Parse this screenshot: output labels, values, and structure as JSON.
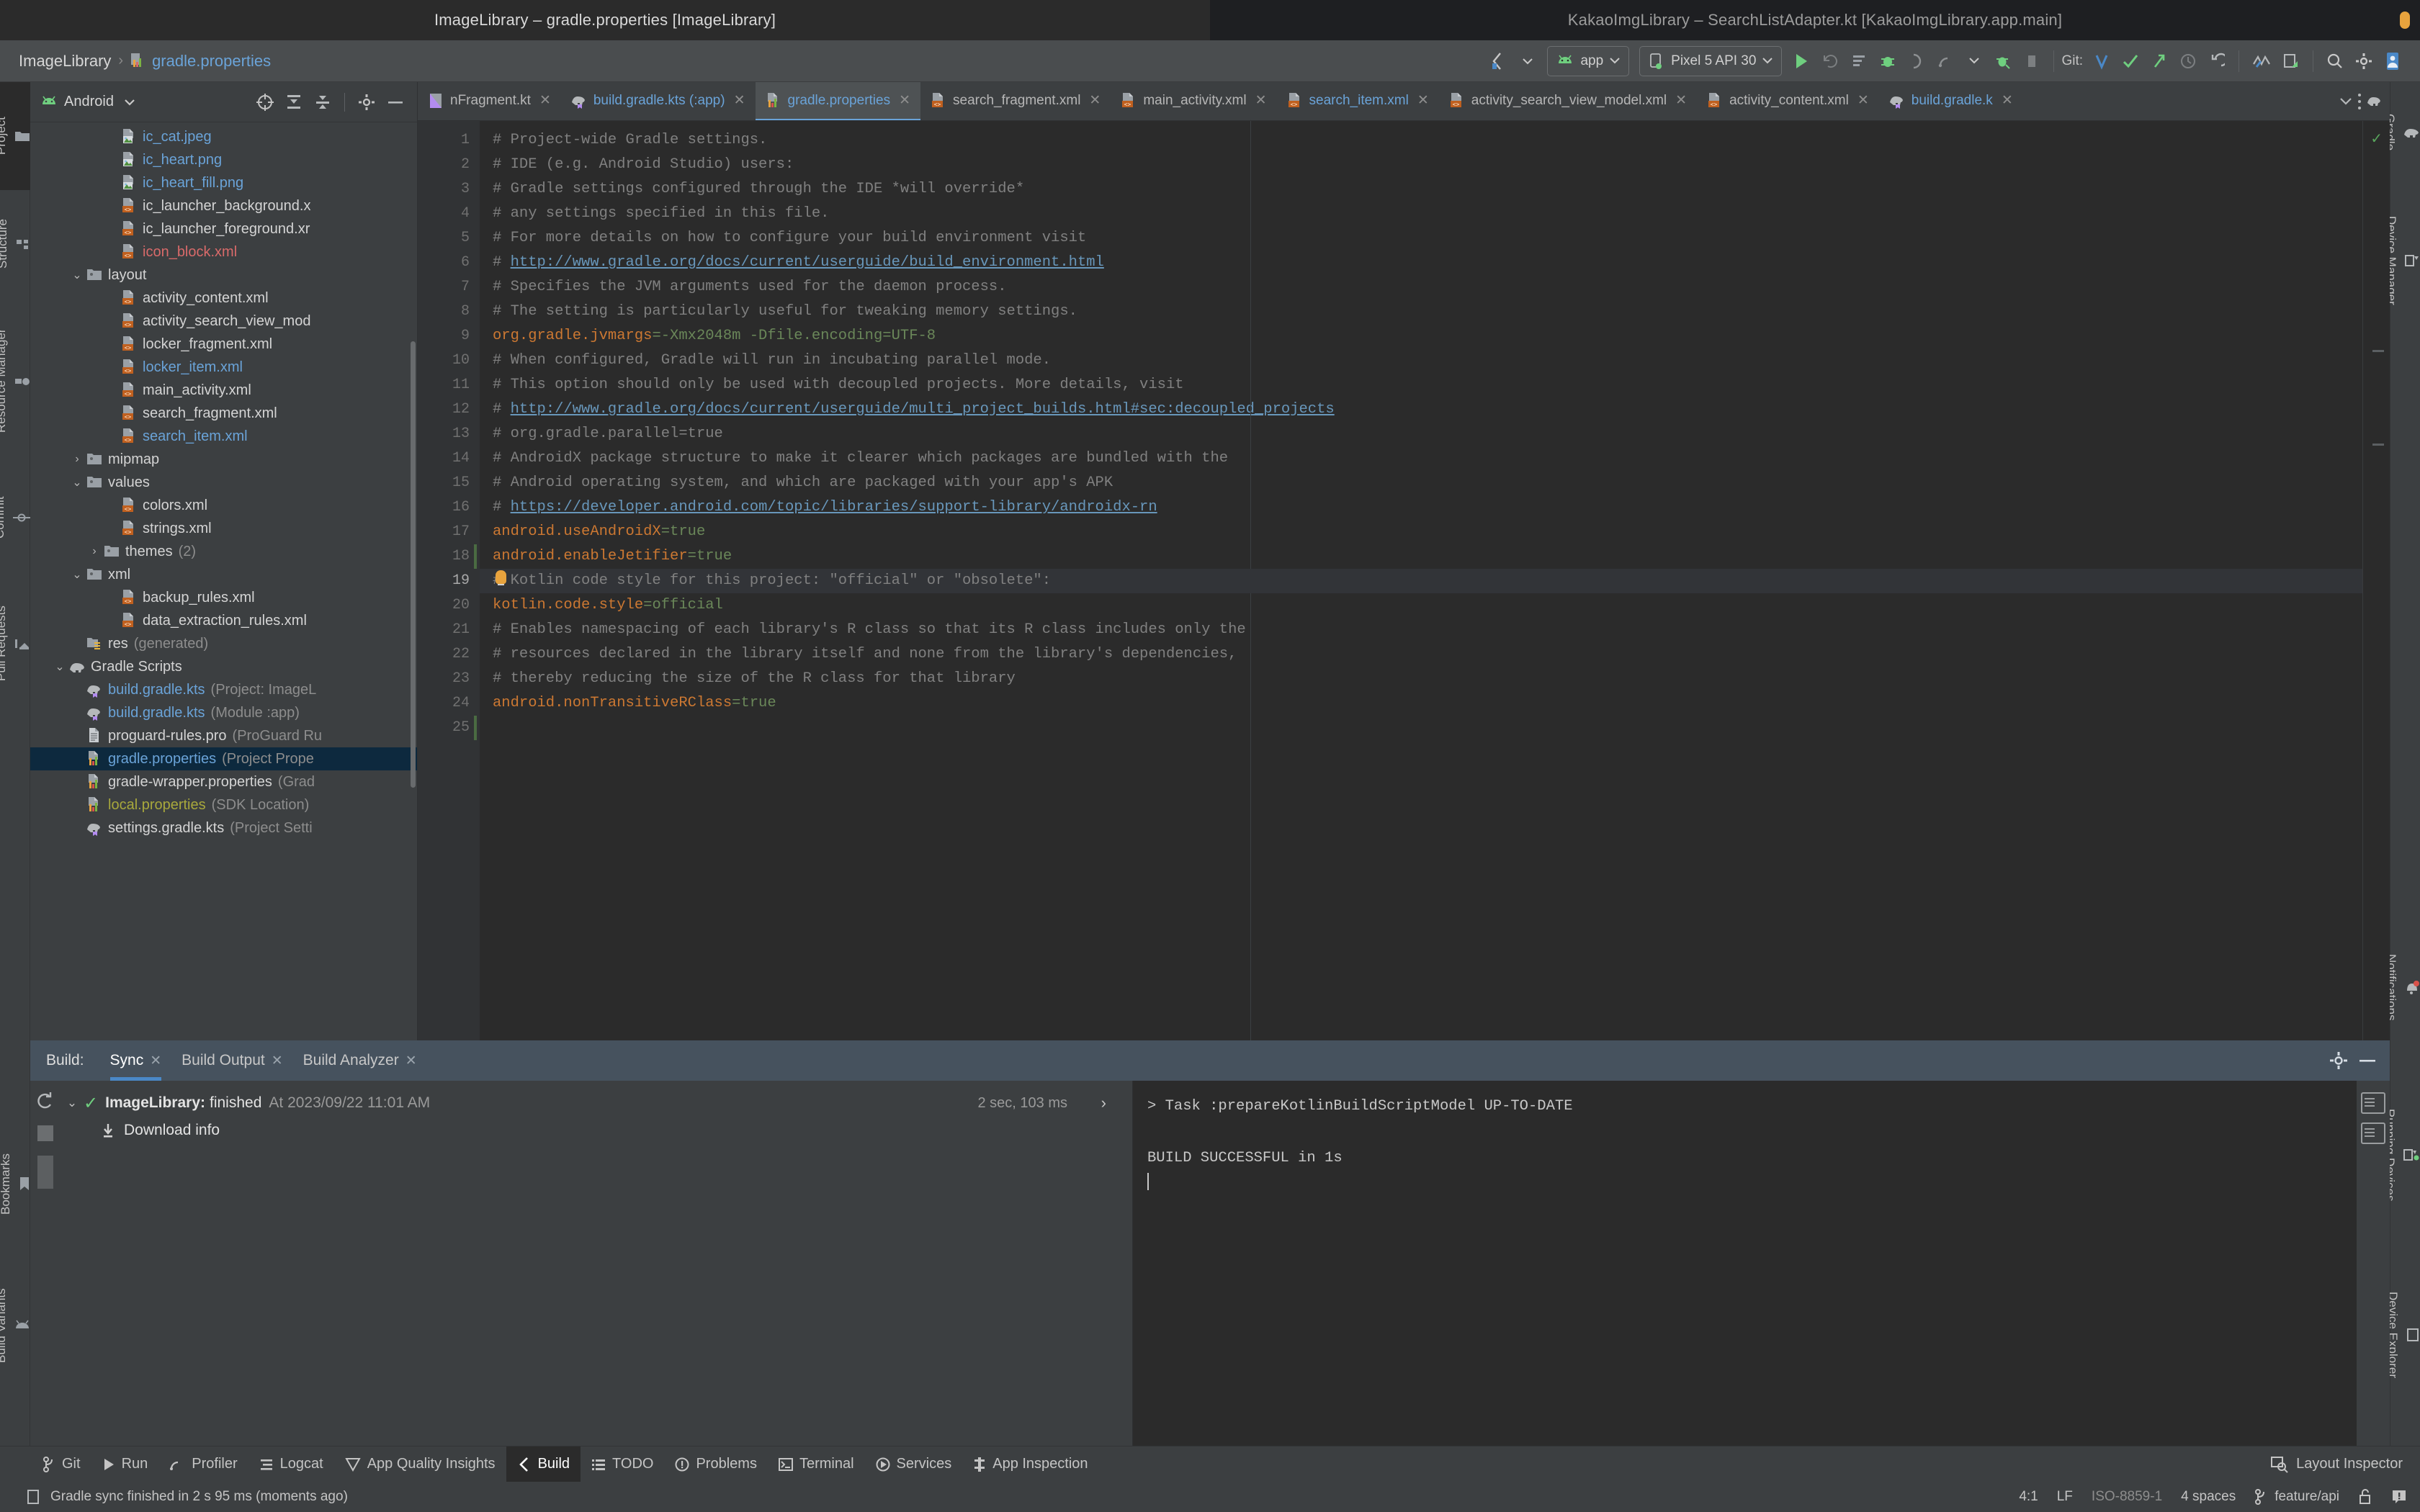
{
  "window": {
    "left_title": "ImageLibrary – gradle.properties [ImageLibrary]",
    "right_title": "KakaoImgLibrary – SearchListAdapter.kt [KakaoImgLibrary.app.main]"
  },
  "breadcrumb": {
    "project": "ImageLibrary",
    "separator": "›",
    "file": "gradle.properties"
  },
  "toolbar": {
    "module_selector": "app",
    "device_selector": "Pixel 5 API 30",
    "git_label": "Git:"
  },
  "project_panel": {
    "view_selector": "Android",
    "tree": [
      {
        "indent": 4,
        "arrow": "",
        "icon": "image-file-icon",
        "label": "ic_cat.jpeg",
        "sub": "",
        "color": "blue",
        "selected": false
      },
      {
        "indent": 4,
        "arrow": "",
        "icon": "image-file-icon",
        "label": "ic_heart.png",
        "sub": "",
        "color": "blue",
        "selected": false
      },
      {
        "indent": 4,
        "arrow": "",
        "icon": "image-file-icon",
        "label": "ic_heart_fill.png",
        "sub": "",
        "color": "blue",
        "selected": false
      },
      {
        "indent": 4,
        "arrow": "",
        "icon": "xml-file-icon",
        "label": "ic_launcher_background.x",
        "sub": "",
        "color": "",
        "selected": false
      },
      {
        "indent": 4,
        "arrow": "",
        "icon": "xml-file-icon",
        "label": "ic_launcher_foreground.xr",
        "sub": "",
        "color": "",
        "selected": false
      },
      {
        "indent": 4,
        "arrow": "",
        "icon": "xml-file-icon",
        "label": "icon_block.xml",
        "sub": "",
        "color": "red",
        "selected": false
      },
      {
        "indent": 2,
        "arrow": "⌄",
        "icon": "folder-icon",
        "label": "layout",
        "sub": "",
        "color": "",
        "selected": false
      },
      {
        "indent": 4,
        "arrow": "",
        "icon": "xml-file-icon",
        "label": "activity_content.xml",
        "sub": "",
        "color": "",
        "selected": false
      },
      {
        "indent": 4,
        "arrow": "",
        "icon": "xml-file-icon",
        "label": "activity_search_view_mod",
        "sub": "",
        "color": "",
        "selected": false
      },
      {
        "indent": 4,
        "arrow": "",
        "icon": "xml-file-icon",
        "label": "locker_fragment.xml",
        "sub": "",
        "color": "",
        "selected": false
      },
      {
        "indent": 4,
        "arrow": "",
        "icon": "xml-file-icon",
        "label": "locker_item.xml",
        "sub": "",
        "color": "blue",
        "selected": false
      },
      {
        "indent": 4,
        "arrow": "",
        "icon": "xml-file-icon",
        "label": "main_activity.xml",
        "sub": "",
        "color": "",
        "selected": false
      },
      {
        "indent": 4,
        "arrow": "",
        "icon": "xml-file-icon",
        "label": "search_fragment.xml",
        "sub": "",
        "color": "",
        "selected": false
      },
      {
        "indent": 4,
        "arrow": "",
        "icon": "xml-file-icon",
        "label": "search_item.xml",
        "sub": "",
        "color": "blue",
        "selected": false
      },
      {
        "indent": 2,
        "arrow": "›",
        "icon": "folder-icon",
        "label": "mipmap",
        "sub": "",
        "color": "",
        "selected": false
      },
      {
        "indent": 2,
        "arrow": "⌄",
        "icon": "folder-icon",
        "label": "values",
        "sub": "",
        "color": "",
        "selected": false
      },
      {
        "indent": 4,
        "arrow": "",
        "icon": "xml-file-icon",
        "label": "colors.xml",
        "sub": "",
        "color": "",
        "selected": false
      },
      {
        "indent": 4,
        "arrow": "",
        "icon": "xml-file-icon",
        "label": "strings.xml",
        "sub": "",
        "color": "",
        "selected": false
      },
      {
        "indent": 3,
        "arrow": "›",
        "icon": "folder-icon",
        "label": "themes",
        "sub": "(2)",
        "color": "",
        "selected": false
      },
      {
        "indent": 2,
        "arrow": "⌄",
        "icon": "folder-icon",
        "label": "xml",
        "sub": "",
        "color": "",
        "selected": false
      },
      {
        "indent": 4,
        "arrow": "",
        "icon": "xml-file-icon",
        "label": "backup_rules.xml",
        "sub": "",
        "color": "",
        "selected": false
      },
      {
        "indent": 4,
        "arrow": "",
        "icon": "xml-file-icon",
        "label": "data_extraction_rules.xml",
        "sub": "",
        "color": "",
        "selected": false
      },
      {
        "indent": 2,
        "arrow": "",
        "icon": "generated-folder-icon",
        "label": "res",
        "sub": "(generated)",
        "color": "",
        "selected": false
      },
      {
        "indent": 1,
        "arrow": "⌄",
        "icon": "gradle-elephant-icon",
        "label": "Gradle Scripts",
        "sub": "",
        "color": "",
        "selected": false
      },
      {
        "indent": 2,
        "arrow": "",
        "icon": "gradle-script-icon",
        "label": "build.gradle.kts",
        "sub": "(Project: ImageL",
        "color": "blue",
        "selected": false
      },
      {
        "indent": 2,
        "arrow": "",
        "icon": "gradle-script-icon",
        "label": "build.gradle.kts",
        "sub": "(Module :app)",
        "color": "blue",
        "selected": false
      },
      {
        "indent": 2,
        "arrow": "",
        "icon": "text-file-icon",
        "label": "proguard-rules.pro",
        "sub": "(ProGuard Ru",
        "color": "",
        "selected": false
      },
      {
        "indent": 2,
        "arrow": "",
        "icon": "properties-file-icon",
        "label": "gradle.properties",
        "sub": "(Project Prope",
        "color": "blue",
        "selected": true
      },
      {
        "indent": 2,
        "arrow": "",
        "icon": "properties-file-icon",
        "label": "gradle-wrapper.properties",
        "sub": "(Grad",
        "color": "",
        "selected": false
      },
      {
        "indent": 2,
        "arrow": "",
        "icon": "properties-file-icon",
        "label": "local.properties",
        "sub": "(SDK Location)",
        "color": "olive",
        "selected": false
      },
      {
        "indent": 2,
        "arrow": "",
        "icon": "gradle-script-icon",
        "label": "settings.gradle.kts",
        "sub": "(Project Setti",
        "color": "",
        "selected": false
      }
    ]
  },
  "editor_tabs": [
    {
      "label": "nFragment.kt",
      "icon": "kotlin-file-icon",
      "active": false,
      "blue": false
    },
    {
      "label": "build.gradle.kts (:app)",
      "icon": "gradle-script-icon",
      "active": false,
      "blue": true
    },
    {
      "label": "gradle.properties",
      "icon": "properties-file-icon",
      "active": true,
      "blue": true
    },
    {
      "label": "search_fragment.xml",
      "icon": "xml-file-icon",
      "active": false,
      "blue": false
    },
    {
      "label": "main_activity.xml",
      "icon": "xml-file-icon",
      "active": false,
      "blue": false
    },
    {
      "label": "search_item.xml",
      "icon": "xml-file-icon",
      "active": false,
      "blue": true
    },
    {
      "label": "activity_search_view_model.xml",
      "icon": "xml-file-icon",
      "active": false,
      "blue": false
    },
    {
      "label": "activity_content.xml",
      "icon": "xml-file-icon",
      "active": false,
      "blue": false
    },
    {
      "label": "build.gradle.k",
      "icon": "gradle-script-icon",
      "active": false,
      "blue": true
    }
  ],
  "code": {
    "cursor_line": 19,
    "lines": [
      {
        "n": 1,
        "tokens": [
          {
            "t": "# Project-wide Gradle settings.",
            "c": "c-comment"
          }
        ]
      },
      {
        "n": 2,
        "tokens": [
          {
            "t": "# IDE (e.g. Android Studio) users:",
            "c": "c-comment"
          }
        ]
      },
      {
        "n": 3,
        "tokens": [
          {
            "t": "# Gradle settings configured through the IDE *will override*",
            "c": "c-comment"
          }
        ]
      },
      {
        "n": 4,
        "tokens": [
          {
            "t": "# any settings specified in this file.",
            "c": "c-comment"
          }
        ]
      },
      {
        "n": 5,
        "tokens": [
          {
            "t": "# For more details on how to configure your build environment visit",
            "c": "c-comment"
          }
        ]
      },
      {
        "n": 6,
        "tokens": [
          {
            "t": "# ",
            "c": "c-comment"
          },
          {
            "t": "http://www.gradle.org/docs/current/userguide/build_environment.html",
            "c": "c-link"
          }
        ]
      },
      {
        "n": 7,
        "tokens": [
          {
            "t": "# Specifies the JVM arguments used for the daemon process.",
            "c": "c-comment"
          }
        ]
      },
      {
        "n": 8,
        "tokens": [
          {
            "t": "# The setting is particularly useful for tweaking memory settings.",
            "c": "c-comment"
          }
        ]
      },
      {
        "n": 9,
        "tokens": [
          {
            "t": "org.gradle.jvmargs",
            "c": "c-key"
          },
          {
            "t": "=-Xmx2048m -Dfile.encoding=UTF-8",
            "c": "c-val"
          }
        ]
      },
      {
        "n": 10,
        "tokens": [
          {
            "t": "# When configured, Gradle will run in incubating parallel mode.",
            "c": "c-comment"
          }
        ]
      },
      {
        "n": 11,
        "tokens": [
          {
            "t": "# This option should only be used with decoupled projects. More details, visit",
            "c": "c-comment"
          }
        ]
      },
      {
        "n": 12,
        "tokens": [
          {
            "t": "# ",
            "c": "c-comment"
          },
          {
            "t": "http://www.gradle.org/docs/current/userguide/multi_project_builds.html#sec:decoupled_projects",
            "c": "c-link"
          }
        ]
      },
      {
        "n": 13,
        "tokens": [
          {
            "t": "# org.gradle.parallel=true",
            "c": "c-comment"
          }
        ]
      },
      {
        "n": 14,
        "tokens": [
          {
            "t": "# AndroidX package structure to make it clearer which packages are bundled with the",
            "c": "c-comment"
          }
        ]
      },
      {
        "n": 15,
        "tokens": [
          {
            "t": "# Android operating system, and which are packaged with your app's APK",
            "c": "c-comment"
          }
        ]
      },
      {
        "n": 16,
        "tokens": [
          {
            "t": "# ",
            "c": "c-comment"
          },
          {
            "t": "https://developer.android.com/topic/libraries/support-library/androidx-rn",
            "c": "c-link"
          }
        ]
      },
      {
        "n": 17,
        "tokens": [
          {
            "t": "android.useAndroidX",
            "c": "c-key"
          },
          {
            "t": "=true",
            "c": "c-val"
          }
        ]
      },
      {
        "n": 18,
        "tokens": [
          {
            "t": "android.enableJetifier",
            "c": "c-key"
          },
          {
            "t": "=true",
            "c": "c-val"
          }
        ]
      },
      {
        "n": 19,
        "tokens": [
          {
            "t": "# Kotlin code style for this project: \"official\" or \"obsolete\":",
            "c": "c-comment"
          }
        ]
      },
      {
        "n": 20,
        "tokens": [
          {
            "t": "kotlin.code.style",
            "c": "c-key"
          },
          {
            "t": "=official",
            "c": "c-val"
          }
        ]
      },
      {
        "n": 21,
        "tokens": [
          {
            "t": "# Enables namespacing of each library's R class so that its R class includes only the",
            "c": "c-comment"
          }
        ]
      },
      {
        "n": 22,
        "tokens": [
          {
            "t": "# resources declared in the library itself and none from the library's dependencies,",
            "c": "c-comment"
          }
        ]
      },
      {
        "n": 23,
        "tokens": [
          {
            "t": "# thereby reducing the size of the R class for that library",
            "c": "c-comment"
          }
        ]
      },
      {
        "n": 24,
        "tokens": [
          {
            "t": "android.nonTransitiveRClass",
            "c": "c-key"
          },
          {
            "t": "=true",
            "c": "c-val"
          }
        ]
      },
      {
        "n": 25,
        "tokens": []
      }
    ]
  },
  "build_panel": {
    "label": "Build:",
    "tabs": [
      {
        "label": "Sync",
        "active": true,
        "closable": true
      },
      {
        "label": "Build Output",
        "active": false,
        "closable": true
      },
      {
        "label": "Build Analyzer",
        "active": false,
        "closable": true
      }
    ],
    "tree": {
      "arrow": "⌄",
      "project": "ImageLibrary:",
      "status": "finished",
      "timestamp": "At 2023/09/22 11:01 AM",
      "duration": "2 sec, 103 ms",
      "child": "Download info"
    },
    "console": [
      "> Task :prepareKotlinBuildScriptModel UP-TO-DATE",
      "",
      "BUILD SUCCESSFUL in 1s"
    ]
  },
  "left_tool_strip": [
    {
      "label": "Project",
      "icon": "project-folder-icon",
      "active": true
    },
    {
      "label": "Structure",
      "icon": "structure-icon",
      "active": false
    },
    {
      "label": "Resource Manager",
      "icon": "resource-manager-icon",
      "active": false
    },
    {
      "label": "Commit",
      "icon": "commit-icon",
      "active": false
    },
    {
      "label": "Pull Requests",
      "icon": "pull-request-icon",
      "active": false
    },
    {
      "label": "Bookmarks",
      "icon": "bookmark-icon",
      "active": false
    },
    {
      "label": "Build Variants",
      "icon": "android-icon",
      "active": false
    }
  ],
  "right_tool_strip": [
    {
      "label": "Gradle",
      "icon": "gradle-elephant-icon"
    },
    {
      "label": "Device Manager",
      "icon": "device-manager-icon"
    },
    {
      "label": "Notifications",
      "icon": "notification-bell-icon"
    },
    {
      "label": "Running Devices",
      "icon": "running-devices-icon"
    },
    {
      "label": "Device Explorer",
      "icon": "device-explorer-icon"
    }
  ],
  "bottom_nav": [
    {
      "label": "Git",
      "icon": "git-branch-icon",
      "active": false
    },
    {
      "label": "Run",
      "icon": "run-icon",
      "active": false
    },
    {
      "label": "Profiler",
      "icon": "profiler-icon",
      "active": false
    },
    {
      "label": "Logcat",
      "icon": "logcat-icon",
      "active": false
    },
    {
      "label": "App Quality Insights",
      "icon": "app-quality-icon",
      "active": false
    },
    {
      "label": "Build",
      "icon": "build-hammer-icon",
      "active": true
    },
    {
      "label": "TODO",
      "icon": "todo-icon",
      "active": false
    },
    {
      "label": "Problems",
      "icon": "problems-icon",
      "active": false
    },
    {
      "label": "Terminal",
      "icon": "terminal-icon",
      "active": false
    },
    {
      "label": "Services",
      "icon": "services-icon",
      "active": false
    },
    {
      "label": "App Inspection",
      "icon": "app-inspection-icon",
      "active": false
    }
  ],
  "bottom_nav_right": {
    "label": "Layout Inspector",
    "icon": "layout-inspector-icon"
  },
  "status_bar": {
    "message": "Gradle sync finished in 2 s 95 ms (moments ago)",
    "caret_position": "4:1",
    "line_separator": "LF",
    "encoding": "ISO-8859-1",
    "indent": "4 spaces",
    "branch": "feature/api"
  },
  "colors": {
    "accent_blue": "#4a88c7",
    "link_blue": "#6aa3d8",
    "success_green": "#58a55c",
    "key_orange": "#cc7832",
    "value_green": "#6a8759",
    "selection": "#0d293e",
    "panel_bg": "#3c3f41",
    "editor_bg": "#2b2b2b"
  }
}
